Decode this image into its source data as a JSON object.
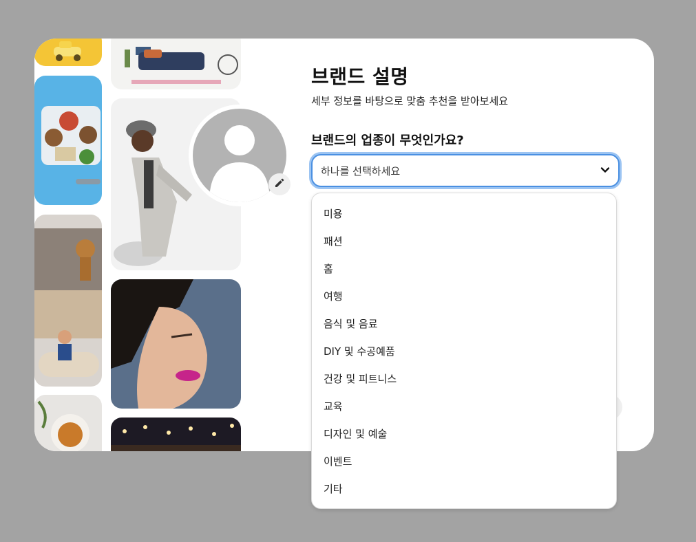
{
  "onboarding": {
    "title": "브랜드 설명",
    "subtitle": "세부 정보를 바탕으로 맞춤 추천을 받아보세요",
    "question": "브랜드의 업종이 무엇인가요?"
  },
  "industry_select": {
    "selected_value": "하나를 선택하세요",
    "options": [
      "미용",
      "패션",
      "홈",
      "여행",
      "음식 및 음료",
      "DIY 및 수공예품",
      "건강 및 피트니스",
      "교육",
      "디자인 및 예술",
      "이벤트",
      "기타"
    ]
  },
  "icons": {
    "dropdown_toggle": "chevron-down-icon",
    "avatar_edit": "pencil-icon",
    "avatar_placeholder": "user-silhouette-icon"
  },
  "colors": {
    "backdrop": "#a3a3a3",
    "modal": "#ffffff",
    "focus_ring": "#4a90e2",
    "avatar_placeholder": "#b3b3b3"
  }
}
